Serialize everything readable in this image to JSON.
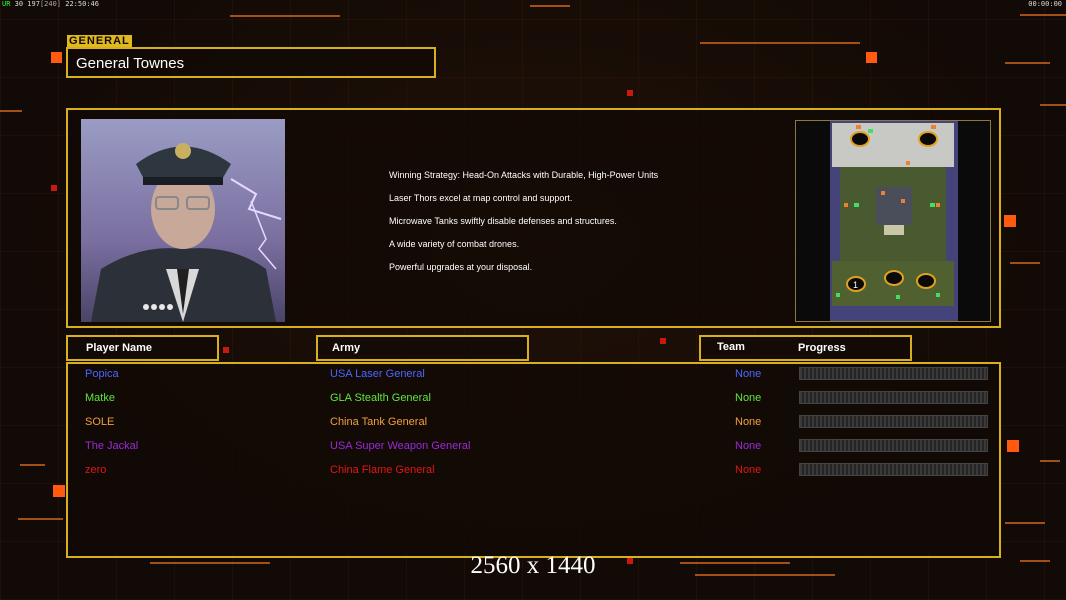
{
  "topbar": {
    "stats_prefix": "UR",
    "stats": "30 197",
    "stats_bracket": "[240]",
    "time": "22:50:46",
    "clock": "00:00:00"
  },
  "general": {
    "tag": "GENERAL",
    "name": "General Townes"
  },
  "strategy": {
    "lines": [
      "Winning Strategy: Head-On Attacks with Durable, High-Power Units",
      "Laser Thors excel at map control and support.",
      "Microwave Tanks swiftly disable defenses and structures.",
      "A wide variety of combat drones.",
      "Powerful upgrades at your disposal."
    ]
  },
  "map": {
    "start_marker": "1"
  },
  "headers": {
    "player_name": "Player Name",
    "army": "Army",
    "team": "Team",
    "progress": "Progress"
  },
  "players": [
    {
      "name": "Popica",
      "army": "USA Laser General",
      "team": "None",
      "color": "#4a66ff"
    },
    {
      "name": "Matke",
      "army": "GLA Stealth General",
      "team": "None",
      "color": "#5ee640"
    },
    {
      "name": "SOLE",
      "army": "China Tank General",
      "team": "None",
      "color": "#f0a040"
    },
    {
      "name": "The Jackal",
      "army": "USA Super Weapon General",
      "team": "None",
      "color": "#9a2ad8"
    },
    {
      "name": "zero",
      "army": "China Flame General",
      "team": "None",
      "color": "#e01818"
    }
  ],
  "resolution": "2560 x 1440",
  "colors": {
    "frame": "#d8b01e",
    "accent": "#ff5a10"
  }
}
